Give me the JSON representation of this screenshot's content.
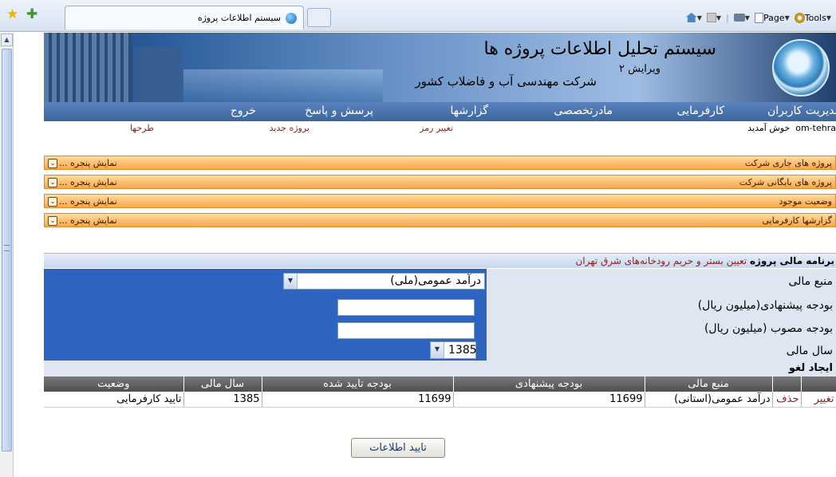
{
  "browser": {
    "tab_title": "سیستم اطلاعات پروژه",
    "toolbar": {
      "page_label": "Page",
      "tools_label": "Tools"
    }
  },
  "banner": {
    "title": "سیستم تحلیل اطلاعات پروژه ها",
    "version": "ویرایش ۲",
    "company": "شرکت مهندسی آب و فاضلاب کشور"
  },
  "menu": {
    "items": [
      "مدیریت کاربران",
      "کارفرمایی",
      "مادرتخصصی",
      "گزارشها",
      "پرسش و پاسخ",
      "خروج"
    ]
  },
  "subbar": {
    "welcome": "خوش آمدید",
    "username": "om-tehra",
    "items": [
      "تغییر رمز",
      "پروژه جدید",
      "طرحها"
    ]
  },
  "panels": [
    {
      "title": "پروژه های جاری شرکت",
      "toggle": "نمایش پنجره ..."
    },
    {
      "title": "پروژه های بایگانی شرکت",
      "toggle": "نمایش پنجره ..."
    },
    {
      "title": "وضعیت موجود",
      "toggle": "نمایش پنجره ..."
    },
    {
      "title": "گزارشها کارفرمایی",
      "toggle": "نمایش پنجره ..."
    }
  ],
  "form": {
    "header_label": "برنامه مالی پروژه",
    "header_value": "تعیین بستر و حریم رودخانه‌های شرق تهران",
    "fields": {
      "source_label": "منبع مالی",
      "source_value": "درآمد عمومی(ملی)",
      "proposed_label": "بودجه پیشنهادی(میلیون ریال)",
      "proposed_value": "",
      "approved_label": "بودجه مصوب (میلیون ریال)",
      "approved_value": "",
      "year_label": "سال مالی",
      "year_value": "1385"
    },
    "action_label": "ایجاد لغو"
  },
  "table": {
    "headers": [
      "منبع مالی",
      "بودجه پیشنهادی",
      "بودجه تایید شده",
      "سال مالی",
      "وضعیت"
    ],
    "rows": [
      {
        "edit": "تغییر",
        "delete": "حذف",
        "source": "درآمد عمومی(استانی)",
        "proposed": "11699",
        "approved": "11699",
        "year": "1385",
        "status": "تایید کارفرمایی"
      }
    ]
  },
  "submit_label": "تایید اطلاعات"
}
